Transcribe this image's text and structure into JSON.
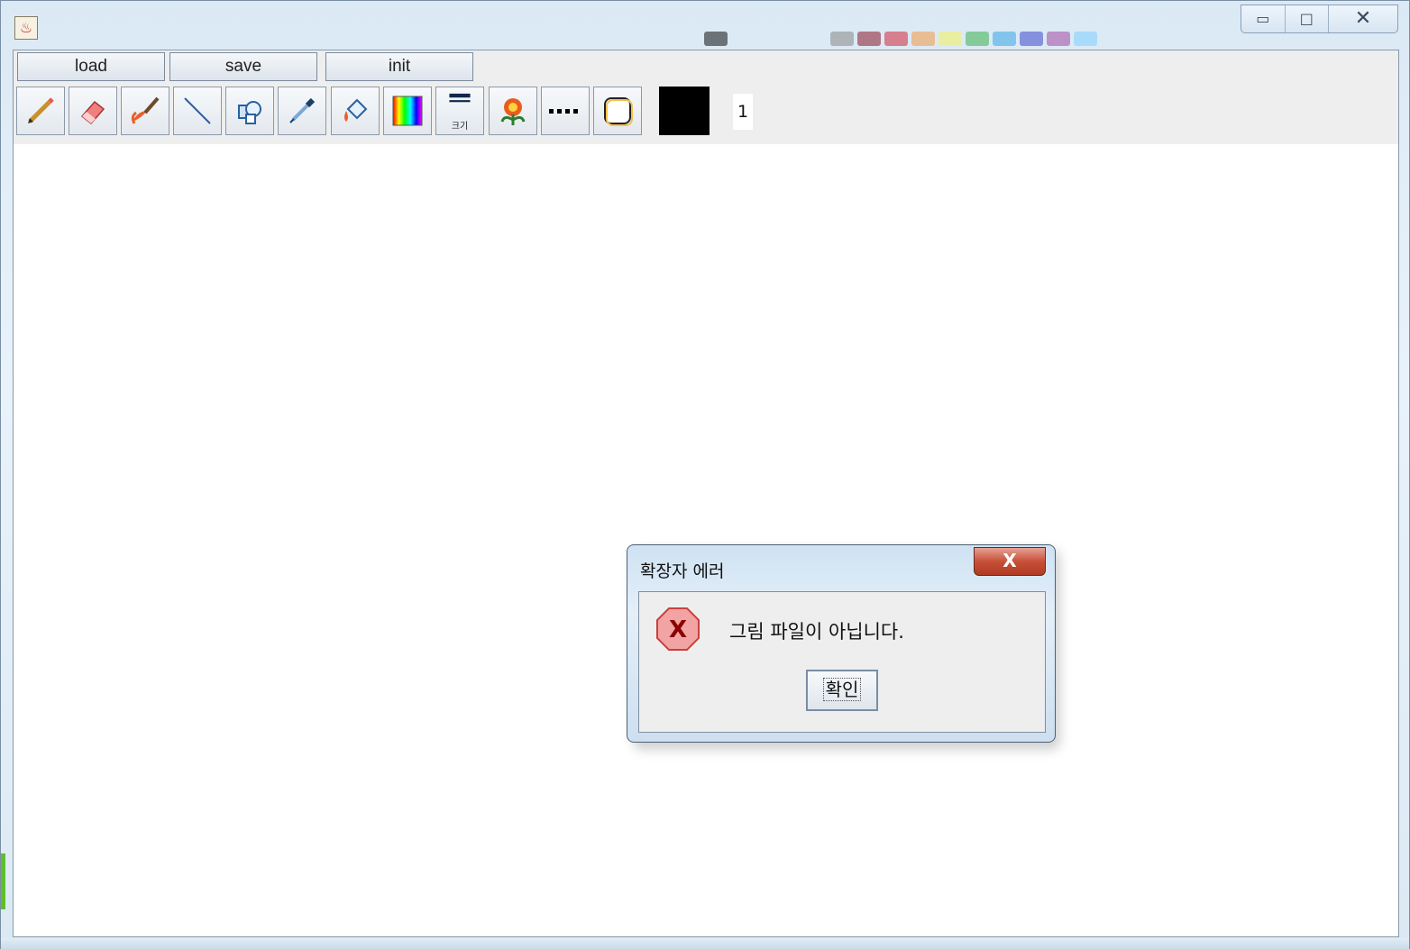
{
  "window": {
    "title_icon": "java-cup-icon",
    "caption": {
      "minimize": "▭",
      "maximize": "□",
      "close": "✕"
    },
    "ghost_swatches": [
      "#111111",
      "#888888",
      "#8b1a2b",
      "#d0283c",
      "#f29a45",
      "#f5f25a",
      "#3fb34f",
      "#39a7e6",
      "#3f48cc",
      "#a349a4",
      "#7fd0ff"
    ]
  },
  "menu": {
    "load": "load",
    "save": "save",
    "init": "init"
  },
  "tools": [
    {
      "id": "pencil",
      "icon": "pencil-icon"
    },
    {
      "id": "eraser",
      "icon": "eraser-icon"
    },
    {
      "id": "brush",
      "icon": "brush-icon"
    },
    {
      "id": "line",
      "icon": "line-icon"
    },
    {
      "id": "shapes",
      "icon": "shapes-icon"
    },
    {
      "id": "eyedropper",
      "icon": "eyedropper-icon"
    },
    {
      "id": "fill",
      "icon": "paint-bucket-icon"
    },
    {
      "id": "color-spectrum",
      "icon": "spectrum-icon"
    },
    {
      "id": "stroke-size",
      "icon": "line-width-icon",
      "label": "크기"
    },
    {
      "id": "image-stamp",
      "icon": "flower-icon"
    },
    {
      "id": "dash-style",
      "icon": "dotted-line-icon"
    },
    {
      "id": "rounded-rect",
      "icon": "rounded-rect-icon"
    }
  ],
  "current_color": "#000000",
  "stroke_size": "1",
  "dialog": {
    "title": "확장자 에러",
    "close_label": "X",
    "message": "그림 파일이 아닙니다.",
    "ok_label": "확인",
    "icon": "error-icon"
  }
}
